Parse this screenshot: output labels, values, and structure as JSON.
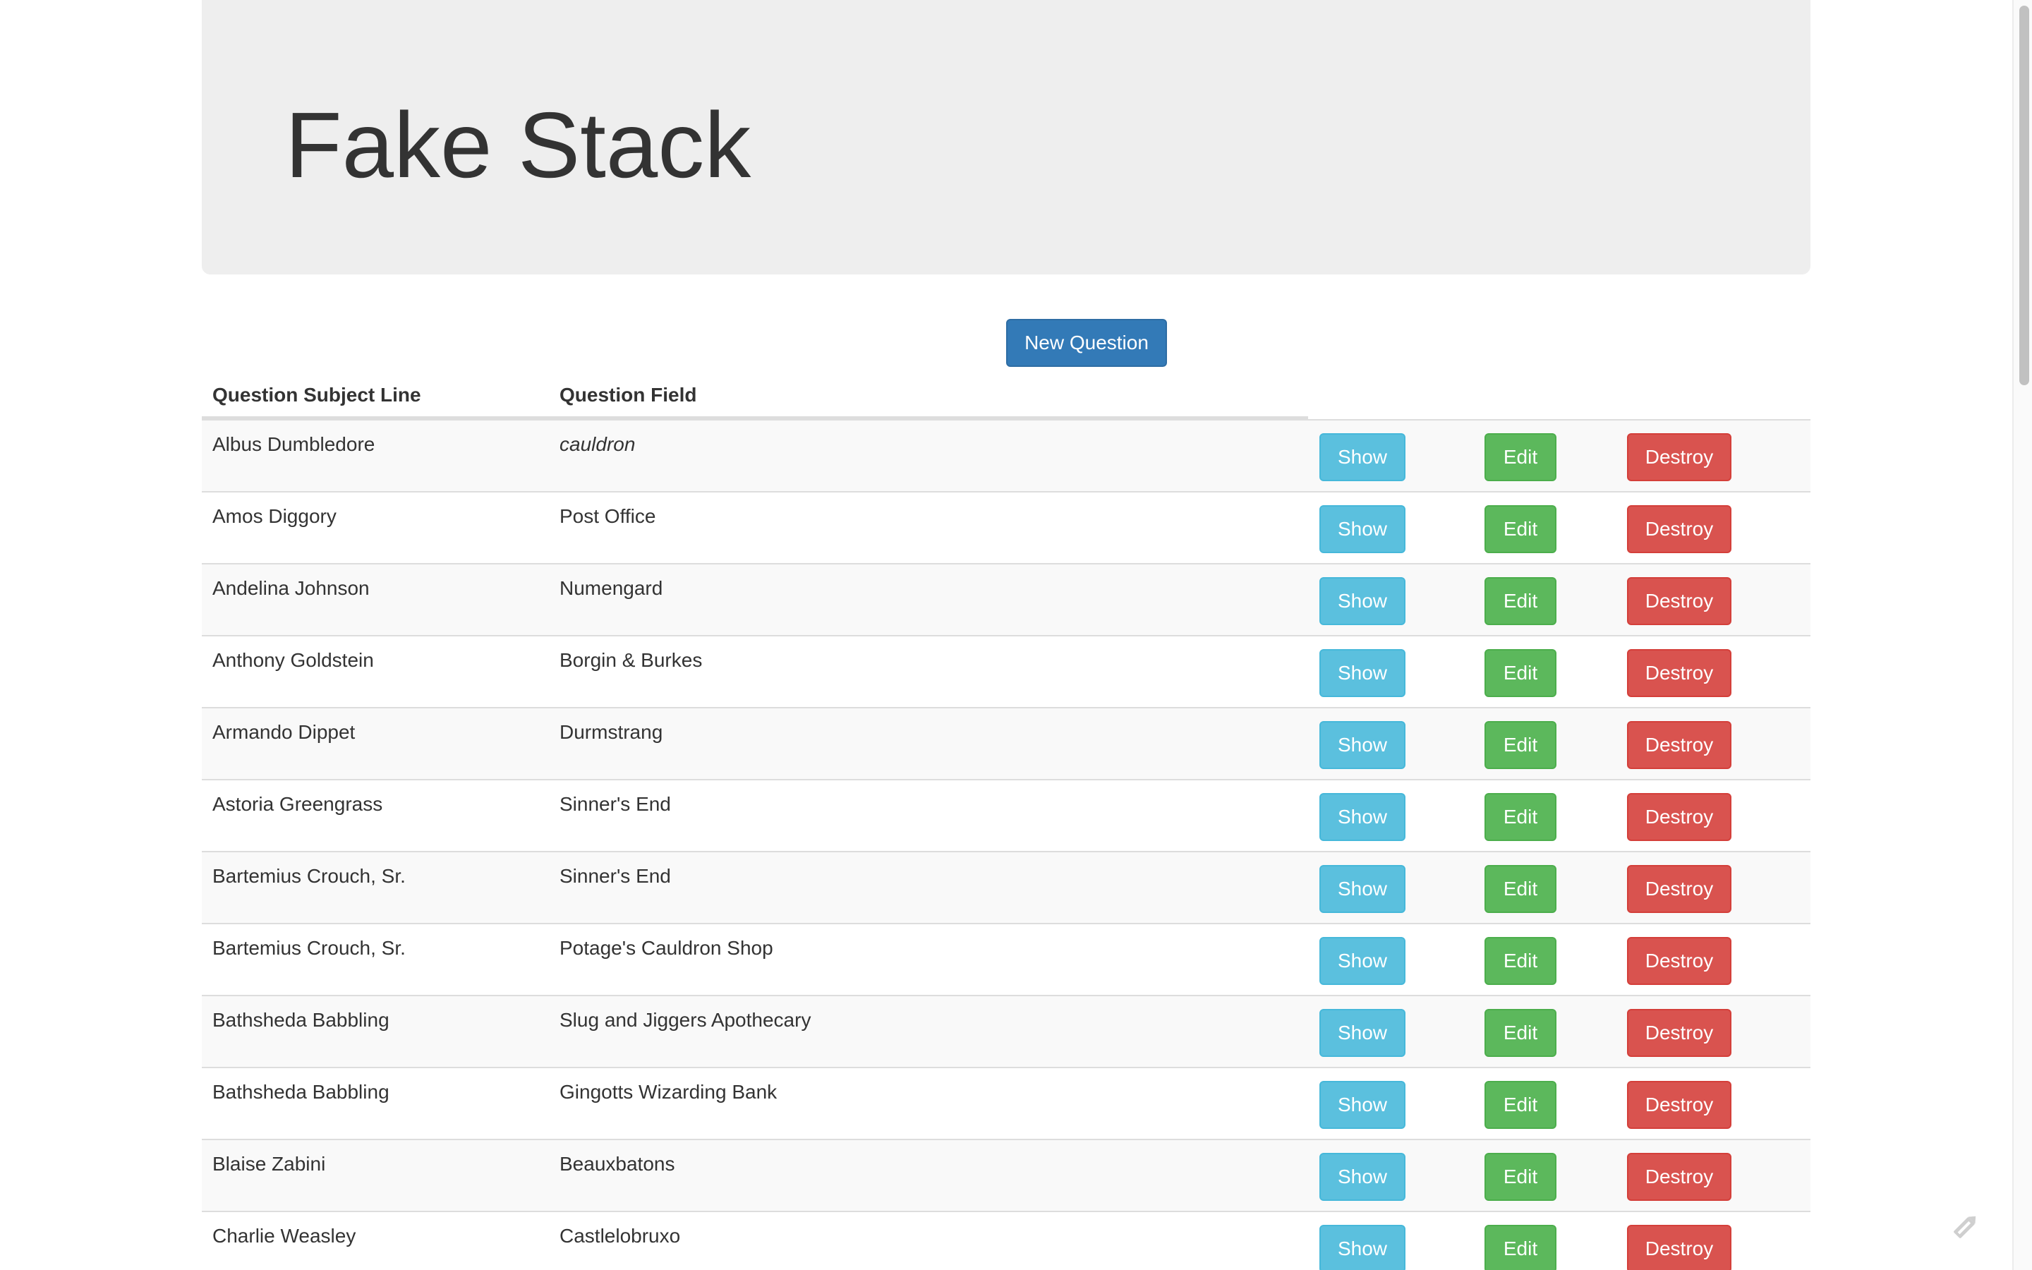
{
  "app": {
    "title": "Fake Stack"
  },
  "toolbar": {
    "new_question_label": "New Question"
  },
  "table": {
    "headers": [
      "Question Subject Line",
      "Question Field"
    ],
    "rows": [
      {
        "subject": "Albus Dumbledore",
        "field": "cauldron",
        "field_italic": true
      },
      {
        "subject": "Amos Diggory",
        "field": "Post Office"
      },
      {
        "subject": "Andelina Johnson",
        "field": "Numengard"
      },
      {
        "subject": "Anthony Goldstein",
        "field": "Borgin & Burkes"
      },
      {
        "subject": "Armando Dippet",
        "field": "Durmstrang"
      },
      {
        "subject": "Astoria Greengrass",
        "field": "Sinner's End"
      },
      {
        "subject": "Bartemius Crouch, Sr.",
        "field": "Sinner's End"
      },
      {
        "subject": "Bartemius Crouch, Sr.",
        "field": "Potage's Cauldron Shop"
      },
      {
        "subject": "Bathsheda Babbling",
        "field": "Slug and Jiggers Apothecary"
      },
      {
        "subject": "Bathsheda Babbling",
        "field": "Gingotts Wizarding Bank"
      },
      {
        "subject": "Blaise Zabini",
        "field": "Beauxbatons"
      },
      {
        "subject": "Charlie Weasley",
        "field": "Castlelobruxo"
      }
    ],
    "actions": {
      "show_label": "Show",
      "edit_label": "Edit",
      "destroy_label": "Destroy"
    }
  },
  "colors": {
    "jumbotron_bg": "#eeeeee",
    "primary": "#337ab7",
    "info": "#5bc0de",
    "success": "#5cb85c",
    "danger": "#d9534f",
    "row_stripe": "#f9f9f9"
  },
  "icons": {
    "floating": "edit-pencil-icon"
  }
}
